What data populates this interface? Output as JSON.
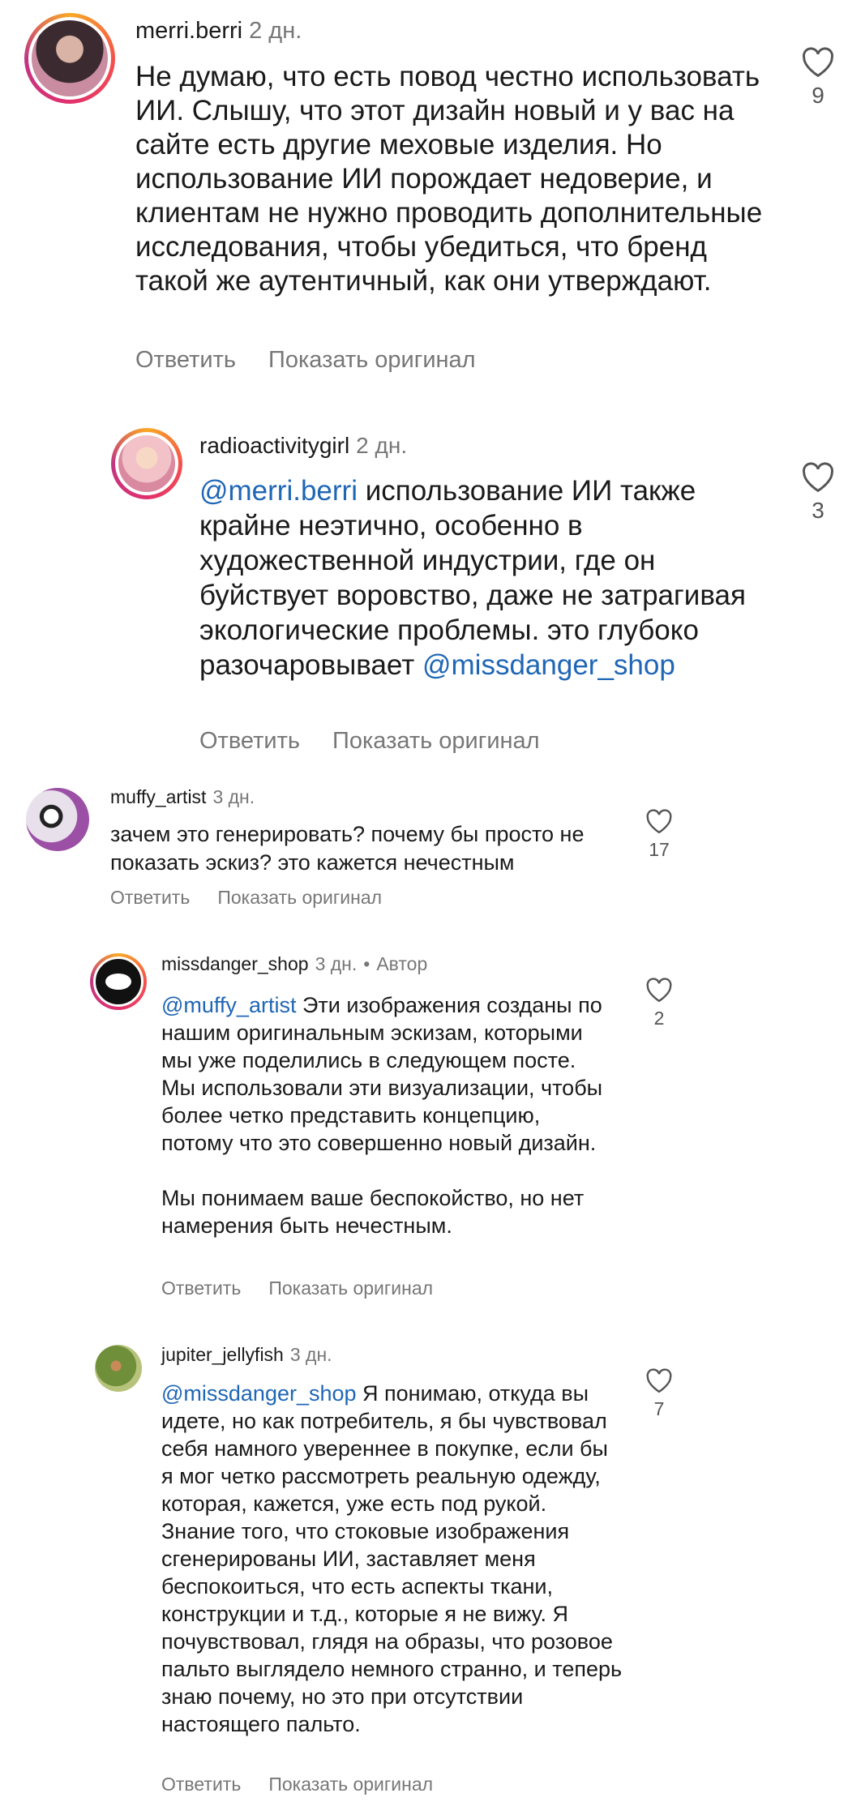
{
  "comments": [
    {
      "username": "merri.berri",
      "time": "2 дн.",
      "text": "Не думаю, что есть повод честно использовать ИИ. Слышу, что этот дизайн новый и у вас на сайте есть другие меховые изделия. Но использование ИИ порождает недоверие, и клиентам не нужно проводить дополнительные исследования, чтобы убедиться, что бренд такой же аутентичный, как они утверждают.",
      "likes": "9",
      "reply_label": "Ответить",
      "show_original_label": "Показать оригинал",
      "avatar_colors": [
        "#3b2a2f",
        "#c98ca0"
      ]
    },
    {
      "username": "radioactivitygirl",
      "time": "2 дн.",
      "mention": "@merri.berri",
      "text": " использование ИИ также крайне неэтично, особенно в художественной индустрии, где он буйствует воровство, даже не затрагивая экологические проблемы. это глубоко разочаровывает ",
      "mention_end": "@missdanger_shop",
      "likes": "3",
      "reply_label": "Ответить",
      "show_original_label": "Показать оригинал",
      "avatar_colors": [
        "#f2c2c8",
        "#d98aa0"
      ]
    },
    {
      "username": "muffy_artist",
      "time": "3 дн.",
      "text": "зачем это генерировать? почему бы просто не показать эскиз? это кажется нечестным",
      "likes": "17",
      "reply_label": "Ответить",
      "show_original_label": "Показать оригинал",
      "avatar_colors": [
        "#e8e0ea",
        "#9b4fa5"
      ]
    },
    {
      "username": "missdanger_shop",
      "time": "3 дн.",
      "author_label": "Автор",
      "mention": "@muffy_artist",
      "text": " Эти изображения созданы по нашим оригинальным эскизам, которыми мы уже поделились в следующем посте. Мы использовали эти визуализации, чтобы более четко представить концепцию, потому что это совершенно новый дизайн.",
      "text2": "Мы понимаем ваше беспокойство, но нет намерения быть нечестным.",
      "likes": "2",
      "reply_label": "Ответить",
      "show_original_label": "Показать оригинал",
      "avatar_colors": [
        "#111111",
        "#ffffff"
      ]
    },
    {
      "username": "jupiter_jellyfish",
      "time": "3 дн.",
      "mention": "@missdanger_shop",
      "text": " Я понимаю, откуда вы идете, но как потребитель, я бы чувствовал себя намного увереннее в покупке, если бы я мог четко рассмотреть реальную одежду, которая, кажется, уже есть под рукой.",
      "text2": "Знание того, что стоковые изображения сгенерированы ИИ, заставляет меня беспокоиться, что есть аспекты ткани, конструкции и т.д., которые я не вижу. Я почувствовал, глядя на образы, что розовое пальто выглядело немного странно, и теперь знаю почему, но это при отсутствии настоящего пальто.",
      "likes": "7",
      "reply_label": "Ответить",
      "show_original_label": "Показать оригинал",
      "avatar_colors": [
        "#6f8f3a",
        "#b7c27a"
      ]
    }
  ],
  "colors": {
    "mention": "#1f66b5",
    "meta": "#777777"
  },
  "icons": {
    "like": "heart-outline-icon"
  }
}
